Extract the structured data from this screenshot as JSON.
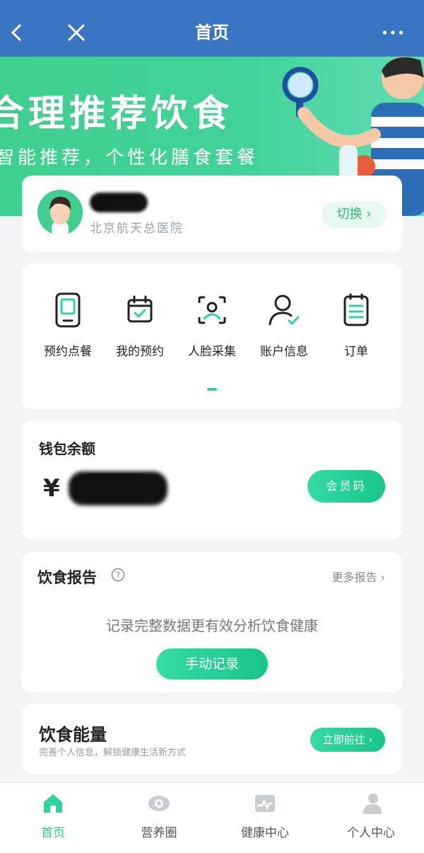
{
  "header": {
    "title": "首页"
  },
  "banner": {
    "headline": "合理推荐饮食",
    "subline": "智能推荐，个性化膳食套餐"
  },
  "profile": {
    "name": "程某",
    "hospital": "北京航天总医院",
    "switch_label": "切换"
  },
  "quick_menu": {
    "items": [
      {
        "label": "预约点餐",
        "icon": "phone-menu-icon"
      },
      {
        "label": "我的预约",
        "icon": "calendar-check-icon"
      },
      {
        "label": "人脸采集",
        "icon": "face-scan-icon"
      },
      {
        "label": "账户信息",
        "icon": "user-check-icon"
      },
      {
        "label": "订单",
        "icon": "order-list-icon"
      }
    ]
  },
  "wallet": {
    "title": "钱包余额",
    "currency": "¥",
    "amount": "1███5",
    "member_code_label": "会员码"
  },
  "diet_report": {
    "title": "饮食报告",
    "more_label": "更多报告",
    "hint": "记录完整数据更有效分析饮食健康",
    "record_label": "手动记录"
  },
  "diet_energy": {
    "title": "饮食能量",
    "subtitle": "完善个人信息，解锁健康生活新方式",
    "go_label": "立即前往"
  },
  "tabbar": {
    "active_color": "#2fc98a",
    "items": [
      {
        "label": "首页",
        "icon": "home-icon",
        "active": true
      },
      {
        "label": "营养圈",
        "icon": "eye-icon",
        "active": false
      },
      {
        "label": "健康中心",
        "icon": "health-chart-icon",
        "active": false
      },
      {
        "label": "个人中心",
        "icon": "person-icon",
        "active": false
      }
    ]
  },
  "colors": {
    "header": "#3a75c4",
    "accent": "#2fd49a",
    "page_bg": "#f2f4f6"
  }
}
